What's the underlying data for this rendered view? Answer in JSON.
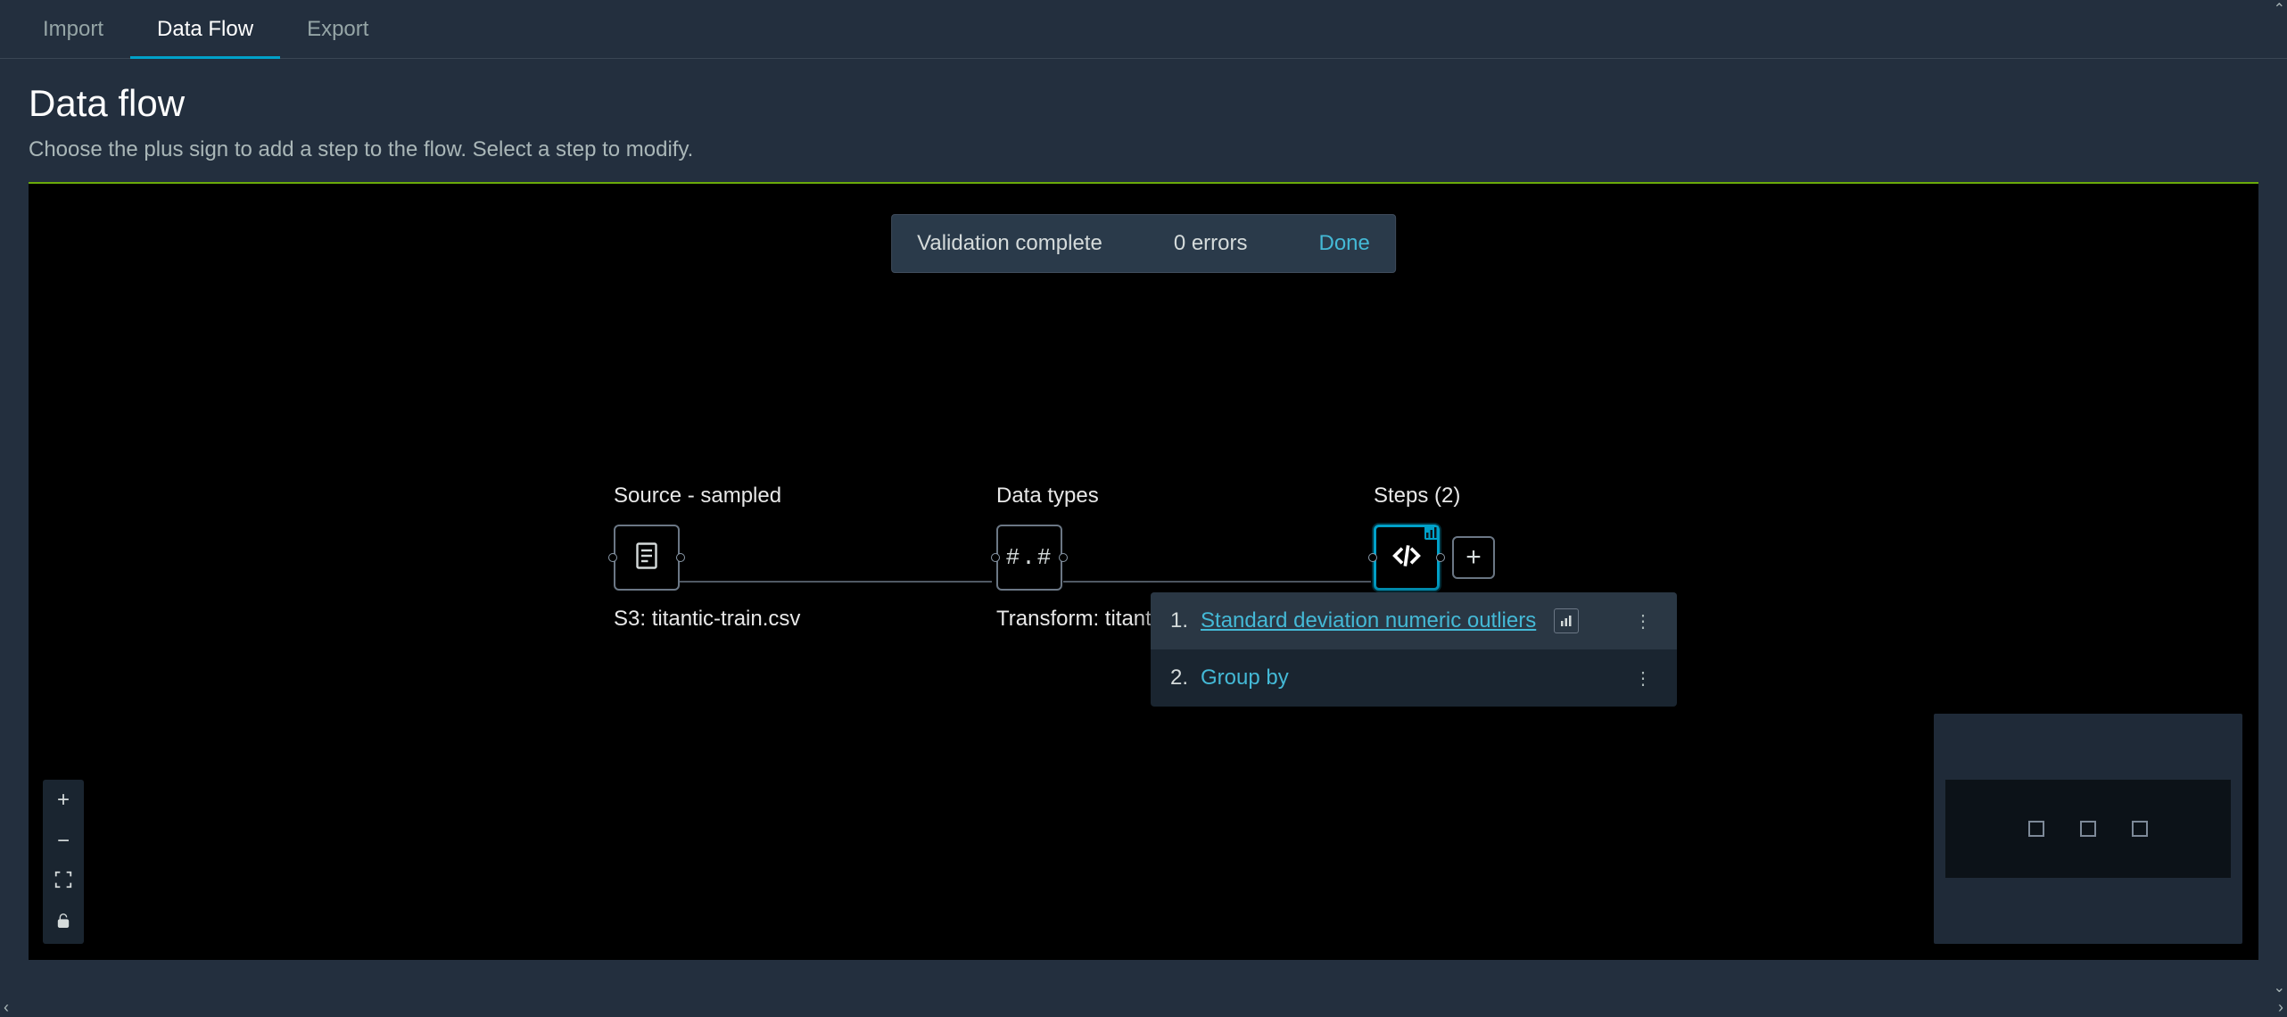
{
  "tabs": {
    "import": "Import",
    "dataflow": "Data Flow",
    "export": "Export"
  },
  "header": {
    "title": "Data flow",
    "subtitle": "Choose the plus sign to add a step to the flow. Select a step to modify."
  },
  "toast": {
    "message": "Validation complete",
    "errors": "0 errors",
    "done": "Done"
  },
  "nodes": {
    "source": {
      "label": "Source - sampled",
      "sub": "S3: titantic-train.csv"
    },
    "types": {
      "label": "Data types",
      "sub": "Transform: titantic",
      "glyph": "#.#"
    },
    "steps": {
      "label": "Steps (2)"
    }
  },
  "steps_popover": {
    "items": [
      {
        "num": "1.",
        "label": "Standard deviation numeric outliers",
        "has_chart": true,
        "highlight": true
      },
      {
        "num": "2.",
        "label": "Group by",
        "has_chart": false,
        "highlight": false
      }
    ]
  }
}
